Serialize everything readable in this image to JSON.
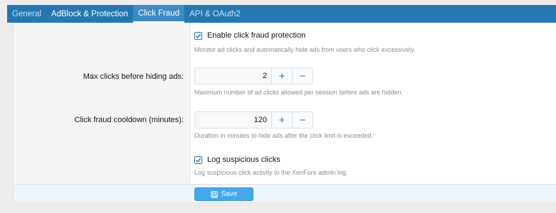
{
  "tabs": [
    {
      "label": "General"
    },
    {
      "label": "AdBlock & Protection"
    },
    {
      "label": "Click Fraud"
    },
    {
      "label": "API & OAuth2"
    }
  ],
  "form": {
    "enable": {
      "label": "Enable click fraud protection",
      "checked": true,
      "hint": "Monitor ad clicks and automatically hide ads from users who click excessively."
    },
    "max_clicks": {
      "label": "Max clicks before hiding ads:",
      "value": "2",
      "hint": "Maximum number of ad clicks allowed per session before ads are hidden."
    },
    "cooldown": {
      "label": "Click fraud cooldown (minutes):",
      "value": "120",
      "hint": "Duration in minutes to hide ads after the click limit is exceeded."
    },
    "log": {
      "label": "Log suspicious clicks",
      "checked": true,
      "hint": "Log suspicious click activity to the XenForo admin log."
    },
    "plus_symbol": "+",
    "minus_symbol": "−",
    "save_label": "Save"
  },
  "icons": {
    "checkbox": "check-icon",
    "save": "save-icon"
  },
  "colors": {
    "accent": "#2577b1",
    "button": "#47a7eb",
    "footer": "#edf4fb"
  }
}
